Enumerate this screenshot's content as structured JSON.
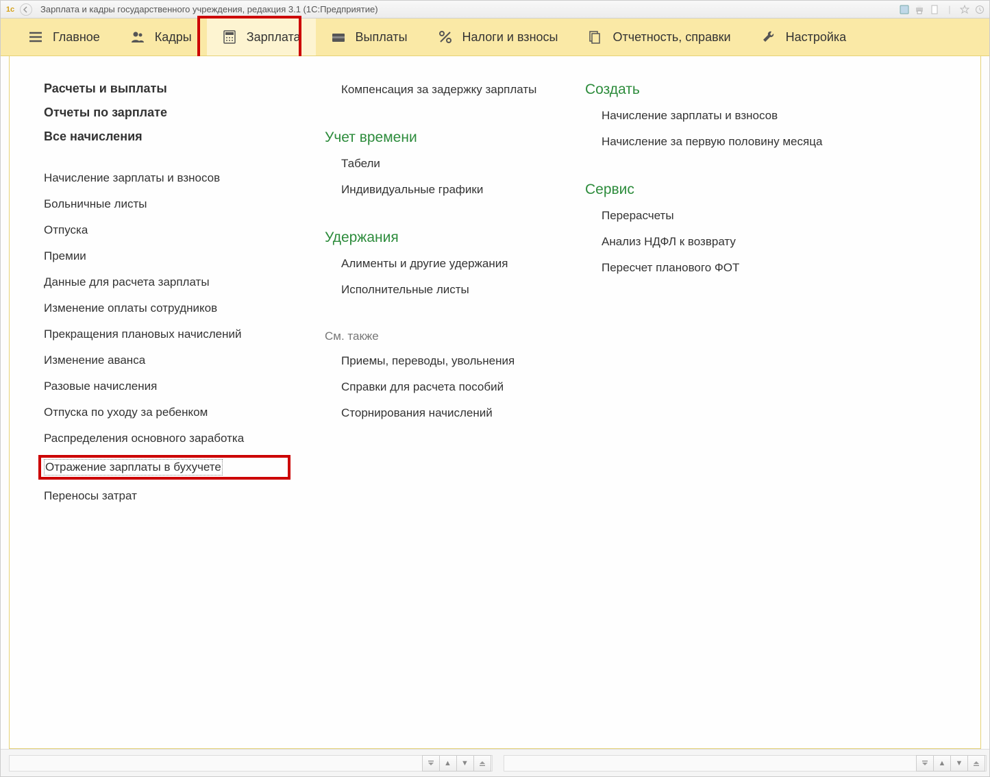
{
  "titlebar": {
    "title": "Зарплата и кадры государственного учреждения, редакция 3.1  (1С:Предприятие)"
  },
  "toolbar": {
    "items": [
      {
        "label": "Главное",
        "icon": "menu-icon"
      },
      {
        "label": "Кадры",
        "icon": "people-icon"
      },
      {
        "label": "Зарплата",
        "icon": "calculator-icon",
        "active": true,
        "highlight": true
      },
      {
        "label": "Выплаты",
        "icon": "wallet-icon"
      },
      {
        "label": "Налоги и взносы",
        "icon": "percent-icon"
      },
      {
        "label": "Отчетность, справки",
        "icon": "files-icon"
      },
      {
        "label": "Настройка",
        "icon": "wrench-icon"
      }
    ]
  },
  "col1": {
    "bold_links": [
      "Расчеты и выплаты",
      "Отчеты по зарплате",
      "Все начисления"
    ],
    "links": [
      "Начисление зарплаты и взносов",
      "Больничные листы",
      "Отпуска",
      "Премии",
      "Данные для расчета зарплаты",
      "Изменение оплаты сотрудников",
      "Прекращения плановых начислений",
      "Изменение аванса",
      "Разовые начисления",
      "Отпуска по уходу за ребенком",
      "Распределения основного заработка",
      "Отражение зарплаты в бухучете",
      "Переносы затрат"
    ],
    "highlighted_index": 11
  },
  "col2": {
    "link_top": "Компенсация за задержку зарплаты",
    "sec1_title": "Учет времени",
    "sec1_links": [
      "Табели",
      "Индивидуальные графики"
    ],
    "sec2_title": "Удержания",
    "sec2_links": [
      "Алименты и другие удержания",
      "Исполнительные листы"
    ],
    "sec3_title": "См. также",
    "sec3_links": [
      "Приемы, переводы, увольнения",
      "Справки для расчета пособий",
      "Сторнирования начислений"
    ]
  },
  "col3": {
    "sec1_title": "Создать",
    "sec1_links": [
      "Начисление зарплаты и взносов",
      "Начисление за первую половину месяца"
    ],
    "sec2_title": "Сервис",
    "sec2_links": [
      "Перерасчеты",
      "Анализ НДФЛ к возврату",
      "Пересчет планового ФОТ"
    ]
  }
}
